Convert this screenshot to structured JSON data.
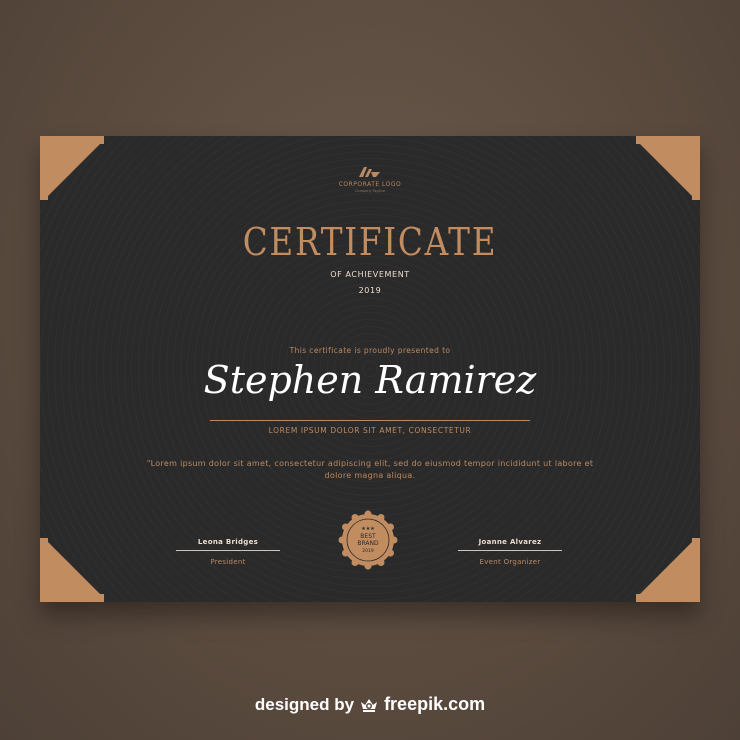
{
  "colors": {
    "background": "#5c4c40",
    "card": "#2b2a2b",
    "accent": "#c08c60",
    "name": "#ffffff"
  },
  "logo": {
    "icon": "monogram-logo-icon",
    "text": "CORPORATE LOGO",
    "tagline": "Company Tagline"
  },
  "certificate": {
    "title": "CERTIFICATE",
    "subtitle": "OF ACHIEVEMENT",
    "year": "2019",
    "presented_to": "This certificate is proudly presented to",
    "recipient": "Stephen Ramirez",
    "recipient_subtitle": "LOREM IPSUM DOLOR SIT AMET, CONSECTETUR",
    "body": "\"Lorem ipsum dolor sit amet, consectetur adipiscing elit, sed do eiusmod tempor incididunt ut labore et dolore magna aliqua."
  },
  "seal": {
    "line1": "BEST",
    "line2": "BRAND",
    "year": "2019",
    "stars": "★★★"
  },
  "signatures": [
    {
      "name": "Leona Bridges",
      "role": "President"
    },
    {
      "name": "Joanne Alvarez",
      "role": "Event Organizer"
    }
  ],
  "credit": {
    "prefix": "designed by",
    "icon": "freepik-crown-icon",
    "brand": "freepik.com"
  }
}
